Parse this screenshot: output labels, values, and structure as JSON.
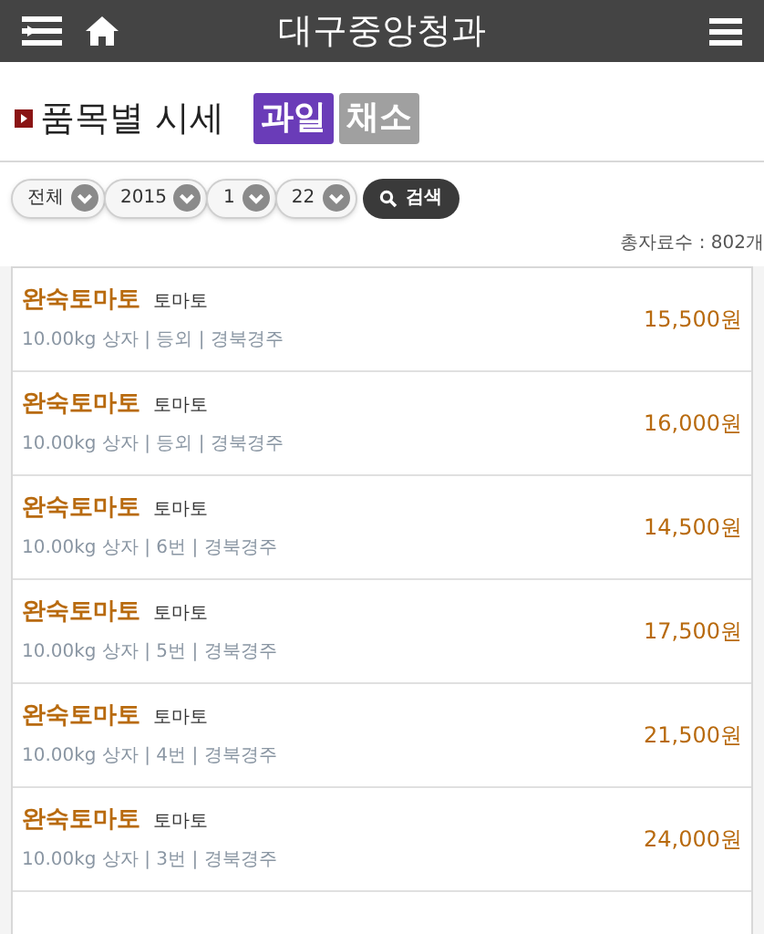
{
  "header": {
    "title": "대구중앙청과"
  },
  "section": {
    "title": "품목별 시세"
  },
  "category_tabs": [
    {
      "label": "과일",
      "selected": true
    },
    {
      "label": "채소",
      "selected": false
    }
  ],
  "filters": [
    {
      "value": "전체"
    },
    {
      "value": "2015"
    },
    {
      "value": "1"
    },
    {
      "value": "22"
    }
  ],
  "search_button": {
    "label": "검색"
  },
  "total_count": "총자료수 : 802개",
  "items": [
    {
      "name": "완숙토마토",
      "variety": "토마토",
      "details": "10.00kg 상자 | 등외 | 경북경주",
      "price": "15,500원"
    },
    {
      "name": "완숙토마토",
      "variety": "토마토",
      "details": "10.00kg 상자 | 등외 | 경북경주",
      "price": "16,000원"
    },
    {
      "name": "완숙토마토",
      "variety": "토마토",
      "details": "10.00kg 상자 | 6번 | 경북경주",
      "price": "14,500원"
    },
    {
      "name": "완숙토마토",
      "variety": "토마토",
      "details": "10.00kg 상자 | 5번 | 경북경주",
      "price": "17,500원"
    },
    {
      "name": "완숙토마토",
      "variety": "토마토",
      "details": "10.00kg 상자 | 4번 | 경북경주",
      "price": "21,500원"
    },
    {
      "name": "완숙토마토",
      "variety": "토마토",
      "details": "10.00kg 상자 | 3번 | 경북경주",
      "price": "24,000원"
    }
  ]
}
